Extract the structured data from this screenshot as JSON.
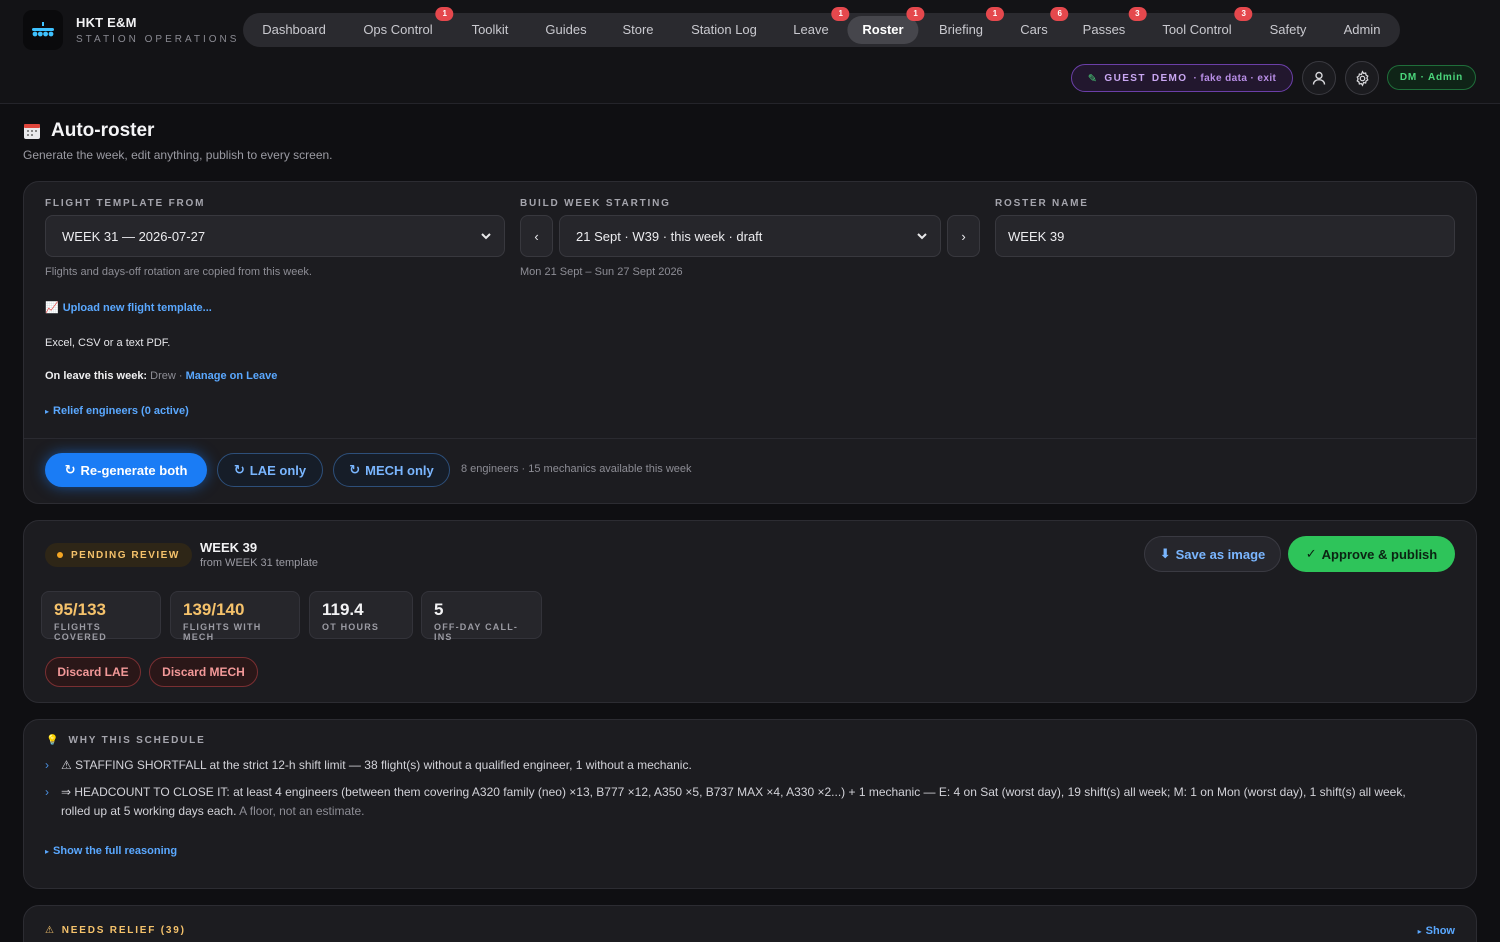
{
  "brand": {
    "title": "HKT E&M",
    "subtitle": "STATION OPERATIONS"
  },
  "nav": [
    {
      "label": "Dashboard",
      "badge": ""
    },
    {
      "label": "Ops Control",
      "badge": "1"
    },
    {
      "label": "Toolkit",
      "badge": ""
    },
    {
      "label": "Guides",
      "badge": ""
    },
    {
      "label": "Store",
      "badge": ""
    },
    {
      "label": "Station Log",
      "badge": ""
    },
    {
      "label": "Leave",
      "badge": "1"
    },
    {
      "label": "Roster",
      "badge": "1",
      "active": true
    },
    {
      "label": "Briefing",
      "badge": "1"
    },
    {
      "label": "Cars",
      "badge": "6"
    },
    {
      "label": "Passes",
      "badge": "3"
    },
    {
      "label": "Tool Control",
      "badge": "3"
    },
    {
      "label": "Safety",
      "badge": ""
    },
    {
      "label": "Admin",
      "badge": ""
    }
  ],
  "guest": {
    "part1": "GUEST",
    "part2": "DEMO",
    "part3": "· fake data · exit"
  },
  "user_pill": "DM · Admin",
  "page": {
    "title": "Auto-roster",
    "subtitle": "Generate the week, edit anything, publish to every screen."
  },
  "config": {
    "template_label": "FLIGHT TEMPLATE FROM",
    "template_value": "WEEK 31 — 2026-07-27",
    "template_hint": "Flights and days-off rotation are copied from this week.",
    "week_label": "BUILD WEEK STARTING",
    "week_value": "21 Sept · W39 · this week · draft",
    "week_hint": "Mon 21 Sept – Sun 27 Sept 2026",
    "name_label": "ROSTER NAME",
    "name_value": "WEEK 39",
    "upload_link": "Upload new flight template...",
    "upload_hint": "Excel, CSV or a text PDF.",
    "leave_prefix": "On leave this week:",
    "leave_names": "Drew ·",
    "leave_link": "Manage on Leave",
    "relief_link": "Relief engineers (0 active)",
    "btn_both": "Re-generate both",
    "btn_lae": "LAE only",
    "btn_mech": "MECH only",
    "availability": "8 engineers · 15 mechanics available this week"
  },
  "review": {
    "status": "PENDING REVIEW",
    "week": "WEEK 39",
    "from": "from WEEK 31 template",
    "save_btn": "Save as image",
    "approve_btn": "Approve & publish",
    "stats": [
      {
        "value": "95/133",
        "key": "FLIGHTS COVERED",
        "color": "#f5c26b"
      },
      {
        "value": "139/140",
        "key": "FLIGHTS WITH MECH",
        "color": "#f5c26b"
      },
      {
        "value": "119.4",
        "key": "OT HOURS",
        "color": "#f2f2f4"
      },
      {
        "value": "5",
        "key": "OFF-DAY CALL-INS",
        "color": "#f2f2f4"
      }
    ],
    "discard_lae": "Discard LAE",
    "discard_mech": "Discard MECH"
  },
  "why": {
    "label": "WHY THIS SCHEDULE",
    "line1": "⚠ STAFFING SHORTFALL at the strict 12-h shift limit — 38 flight(s) without a qualified engineer, 1 without a mechanic.",
    "line2": "⇒ HEADCOUNT TO CLOSE IT: at least 4 engineers (between them covering A320 family (neo) ×13, B777 ×12, A350 ×5, B737 MAX ×4, A330 ×2...) + 1 mechanic — E: 4 on Sat (worst day), 19 shift(s) all week; M: 1 on Mon (worst day), 1 shift(s) all week,",
    "line3a": "rolled up at 5 working days each.",
    "line3b": "A floor, not an estimate.",
    "more_link": "Show the full reasoning"
  },
  "relief": {
    "label": "NEEDS RELIEF (39)",
    "show": "Show"
  }
}
